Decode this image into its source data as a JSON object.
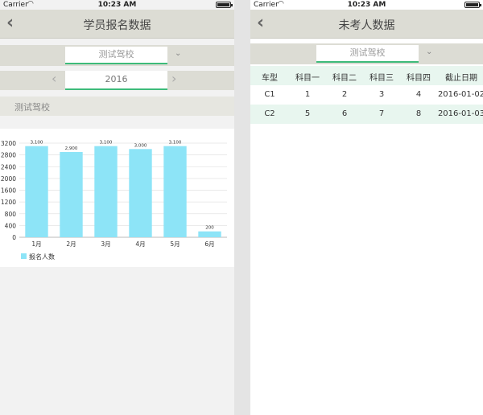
{
  "left": {
    "status": {
      "carrier": "Carrier",
      "time": "10:23 AM"
    },
    "nav": {
      "back": "‹",
      "title": "学员报名数据"
    },
    "school": {
      "value": "测试驾校",
      "arrow": "⌄"
    },
    "year": {
      "value": "2016",
      "prev": "‹",
      "next": "›"
    },
    "section_title": "测试驾校",
    "legend_label": "报名人数"
  },
  "right": {
    "status": {
      "carrier": "Carrier",
      "time": "10:23 AM"
    },
    "nav": {
      "back": "‹",
      "title": "未考人数据"
    },
    "school": {
      "value": "测试驾校",
      "arrow": "⌄"
    },
    "table": {
      "headers": [
        "车型",
        "科目一",
        "科目二",
        "科目三",
        "科目四",
        "截止日期"
      ],
      "rows": [
        [
          "C1",
          "1",
          "2",
          "3",
          "4",
          "2016-01-02"
        ],
        [
          "C2",
          "5",
          "6",
          "7",
          "8",
          "2016-01-03"
        ]
      ]
    }
  },
  "colors": {
    "accent": "#3dbb7a",
    "bar": "#8de4f7",
    "nav_bg": "#dcdcd4"
  },
  "chart_data": {
    "type": "bar",
    "categories": [
      "1月",
      "2月",
      "3月",
      "4月",
      "5月",
      "6月"
    ],
    "series": [
      {
        "name": "报名人数",
        "values": [
          3100,
          2900,
          3100,
          3000,
          3100,
          200
        ]
      }
    ],
    "data_labels": [
      "3,100",
      "2,900",
      "3,100",
      "3,000",
      "3,100",
      "200"
    ],
    "y_ticks": [
      "0",
      "400",
      "800",
      "1200",
      "1600",
      "2000",
      "2400",
      "2800",
      "3200"
    ],
    "ylim": [
      0,
      3200
    ],
    "grid": true,
    "legend": "bottom-left"
  }
}
